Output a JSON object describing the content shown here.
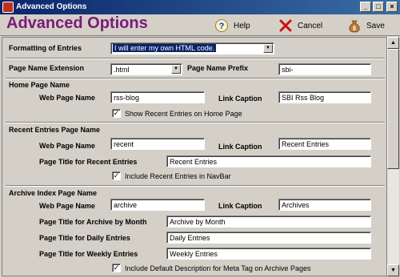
{
  "window": {
    "title": "Advanced Options"
  },
  "header": {
    "title": "Advanced Options",
    "help_label": "Help",
    "cancel_label": "Cancel",
    "save_label": "Save"
  },
  "formatting": {
    "label": "Formatting of Entries",
    "value": "I will enter my own HTML code."
  },
  "page_name": {
    "ext_label": "Page Name Extension",
    "ext_value": ".html",
    "prefix_label": "Page Name Prefix",
    "prefix_value": "sbi-"
  },
  "home": {
    "section_label": "Home Page Name",
    "web_label": "Web Page Name",
    "web_value": "rss-blog",
    "caption_label": "Link Caption",
    "caption_value": "SBI Rss Blog",
    "checkbox_label": "Show Recent Entries on Home Page"
  },
  "recent": {
    "section_label": "Recent Entries Page Name",
    "web_label": "Web Page Name",
    "web_value": "recent",
    "caption_label": "Link Caption",
    "caption_value": "Recent Entries",
    "title_label": "Page Title for Recent Entries",
    "title_value": "Recent Entries",
    "checkbox_label": "Include Recent Entries in NavBar"
  },
  "archive": {
    "section_label": "Archive Index Page Name",
    "web_label": "Web Page Name",
    "web_value": "archive",
    "caption_label": "Link Caption",
    "caption_value": "Archives",
    "month_label": "Page Title for Archive by Month",
    "month_value": "Archive by Month",
    "daily_label": "Page Title for Daily Entries",
    "daily_value": "Daily Entries",
    "weekly_label": "Page Title for Weekly Entries",
    "weekly_value": "Weekly Entries",
    "checkbox_label": "Include Default Description for Meta Tag on Archive Pages"
  },
  "icons": {
    "help": "help-question-icon",
    "cancel": "red-x-icon",
    "save": "money-bag-save-icon"
  }
}
